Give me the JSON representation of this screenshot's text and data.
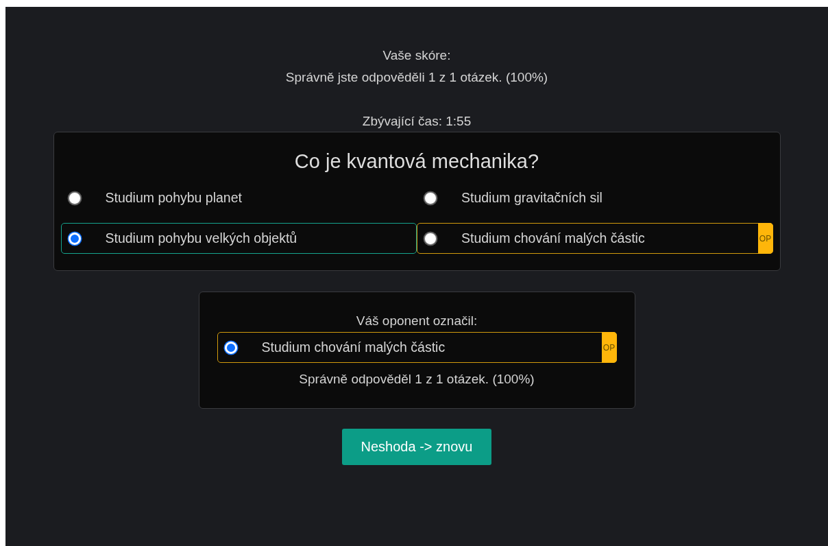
{
  "score": {
    "heading": "Vaše skóre:",
    "result": "Správně jste odpověděli 1 z 1 otázek. (100%)",
    "time_left": "Zbývající čas: 1:55"
  },
  "question": {
    "title": "Co je kvantová mechanika?",
    "options": [
      {
        "label": "Studium pohybu planet",
        "selected": false,
        "mine": false
      },
      {
        "label": "Studium gravitačních sil",
        "selected": false,
        "mine": false
      },
      {
        "label": "Studium pohybu velkých objektů",
        "selected": true,
        "mine": true
      },
      {
        "label": "Studium chování malých částic",
        "selected": false,
        "mine": false,
        "badge": "OP"
      }
    ]
  },
  "opponent": {
    "heading": "Váš oponent označil:",
    "option": {
      "label": "Studium chování malých částic",
      "selected": true,
      "badge": "OP"
    },
    "result": "Správně odpověděl 1 z 1 otázek. (100%)"
  },
  "button": "Neshoda -> znovu"
}
